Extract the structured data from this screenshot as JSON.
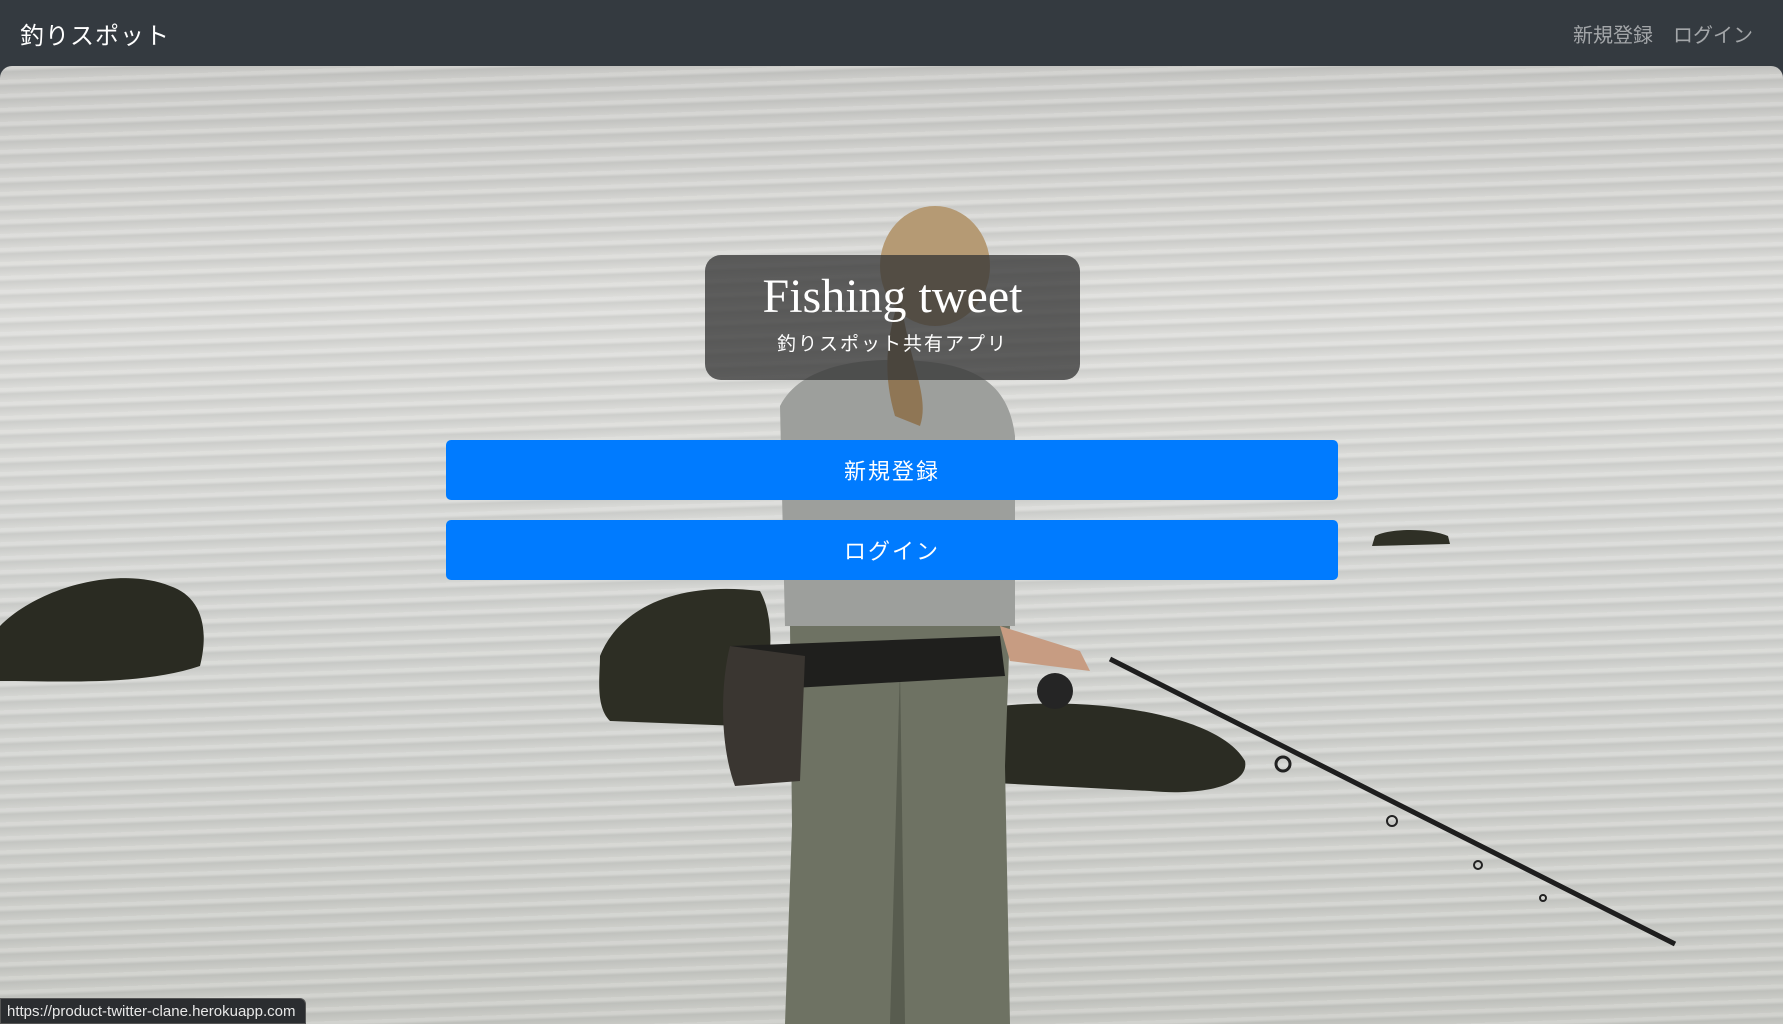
{
  "navbar": {
    "brand": "釣りスポット",
    "links": [
      "新規登録",
      "ログイン"
    ]
  },
  "hero": {
    "title": "Fishing tweet",
    "subtitle": "釣りスポット共有アプリ",
    "signup_button": "新規登録",
    "login_button": "ログイン"
  },
  "status_bar": {
    "url": "https://product-twitter-clane.herokuapp.com"
  },
  "colors": {
    "navbar_bg": "#343a40",
    "button_primary": "#007bff"
  }
}
